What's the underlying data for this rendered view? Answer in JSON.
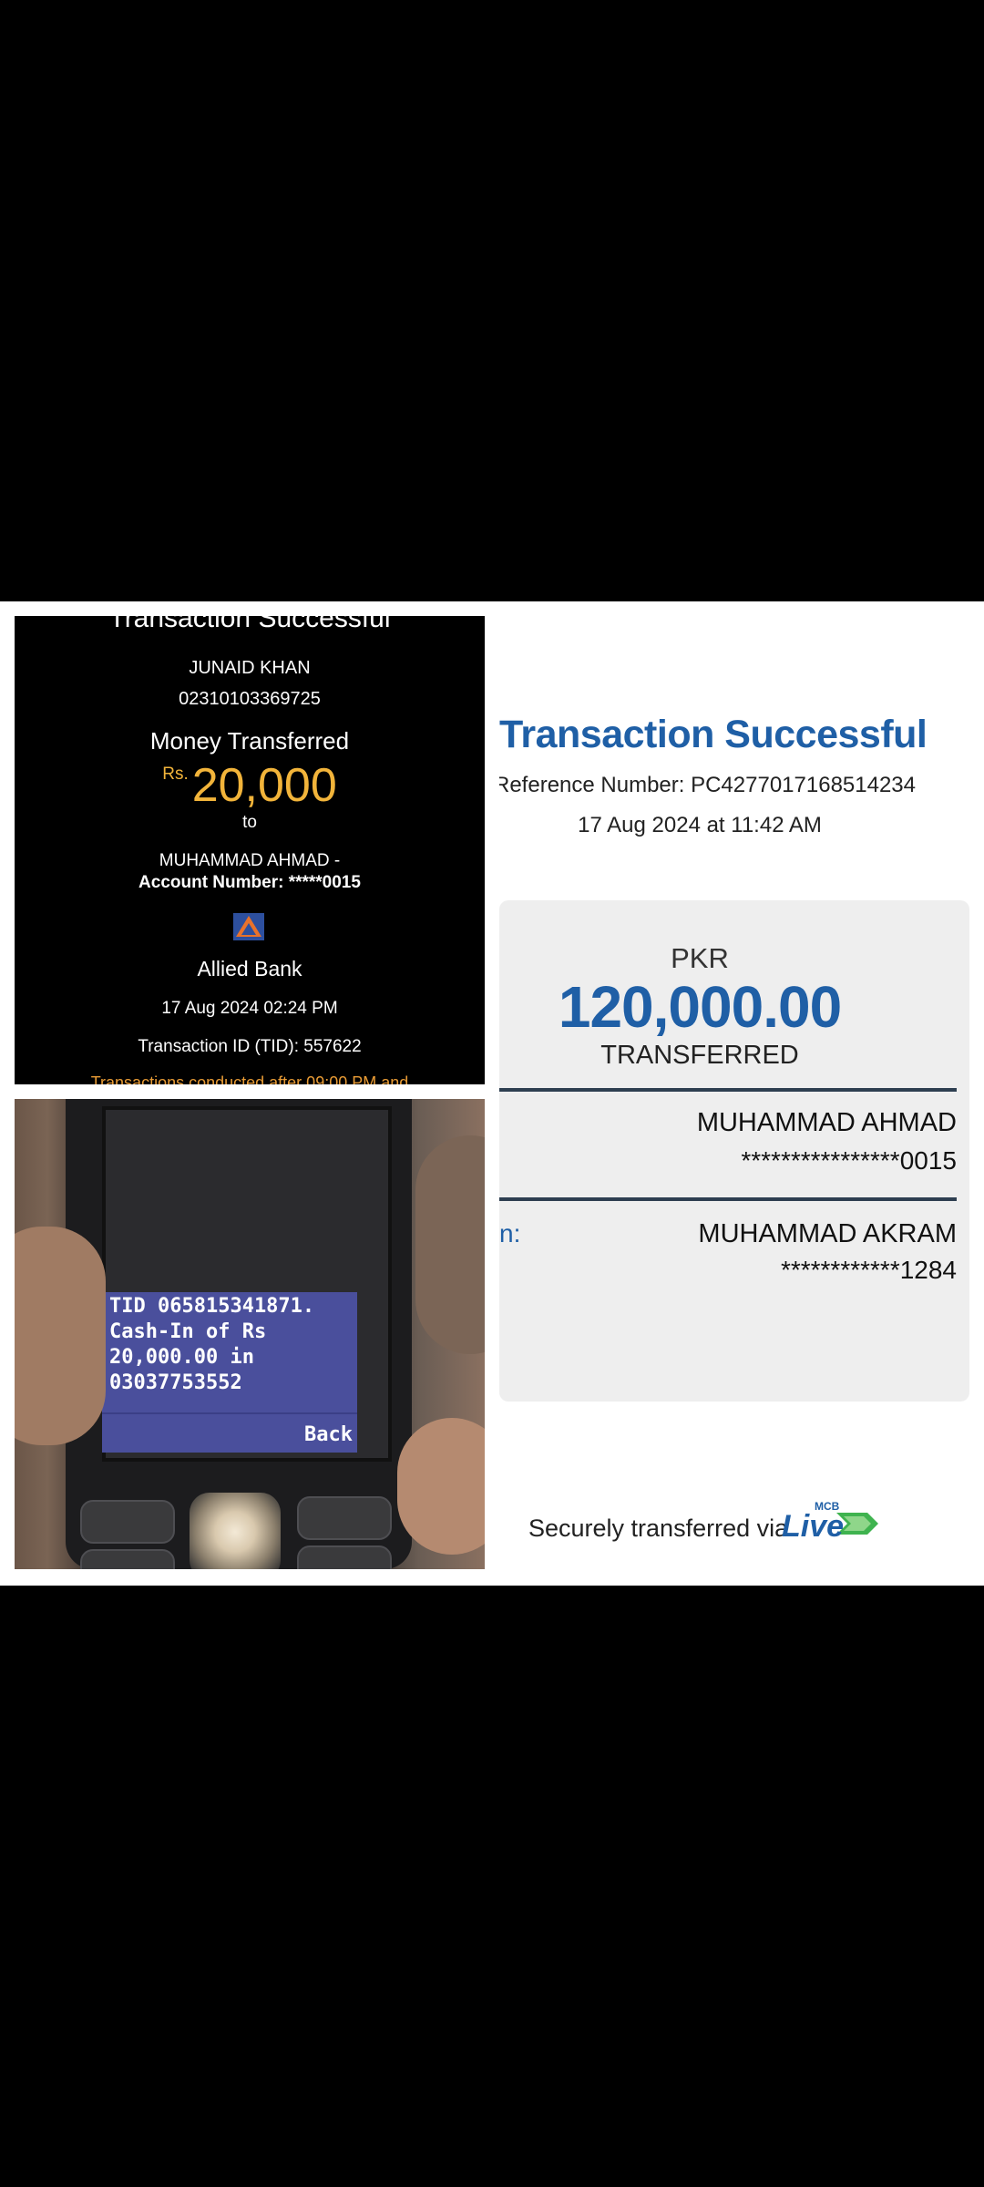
{
  "bank_receipt": {
    "title_cut": "Transaction Successful",
    "sender_name": "JUNAID KHAN",
    "sender_account": "02310103369725",
    "heading": "Money Transferred",
    "currency": "Rs.",
    "amount": "20,000",
    "to": "to",
    "recipient": "MUHAMMAD AHMAD -",
    "recipient_account": "Account Number: *****0015",
    "bank_name": "Allied Bank",
    "datetime": "17 Aug 2024 02:24 PM",
    "tid": "Transaction ID (TID): 557622",
    "footer_cut": "Transactions conducted after 09:00 PM and",
    "accent_color": "#f2b43a"
  },
  "phone_photo": {
    "sms_text": "TID 065815341871.\nCash-In of Rs\n20,000.00 in\n03037753552",
    "softkey": "Back"
  },
  "mcb_receipt": {
    "title": "Transaction Successful",
    "reference": "Reference Number: PC4277017168514234",
    "datetime": "17 Aug 2024 at 11:42 AM",
    "currency": "PKR",
    "amount": "120,000.00",
    "status": "TRANSFERRED",
    "to_name": "MUHAMMAD AHMAD",
    "to_account": "****************0015",
    "from_label": "n:",
    "from_name": "MUHAMMAD AKRAM",
    "from_account": "************1284",
    "secure_text": "Securely transferred via",
    "brand_small": "MCB",
    "brand": "Live",
    "brand_color": "#1f5fa6"
  }
}
